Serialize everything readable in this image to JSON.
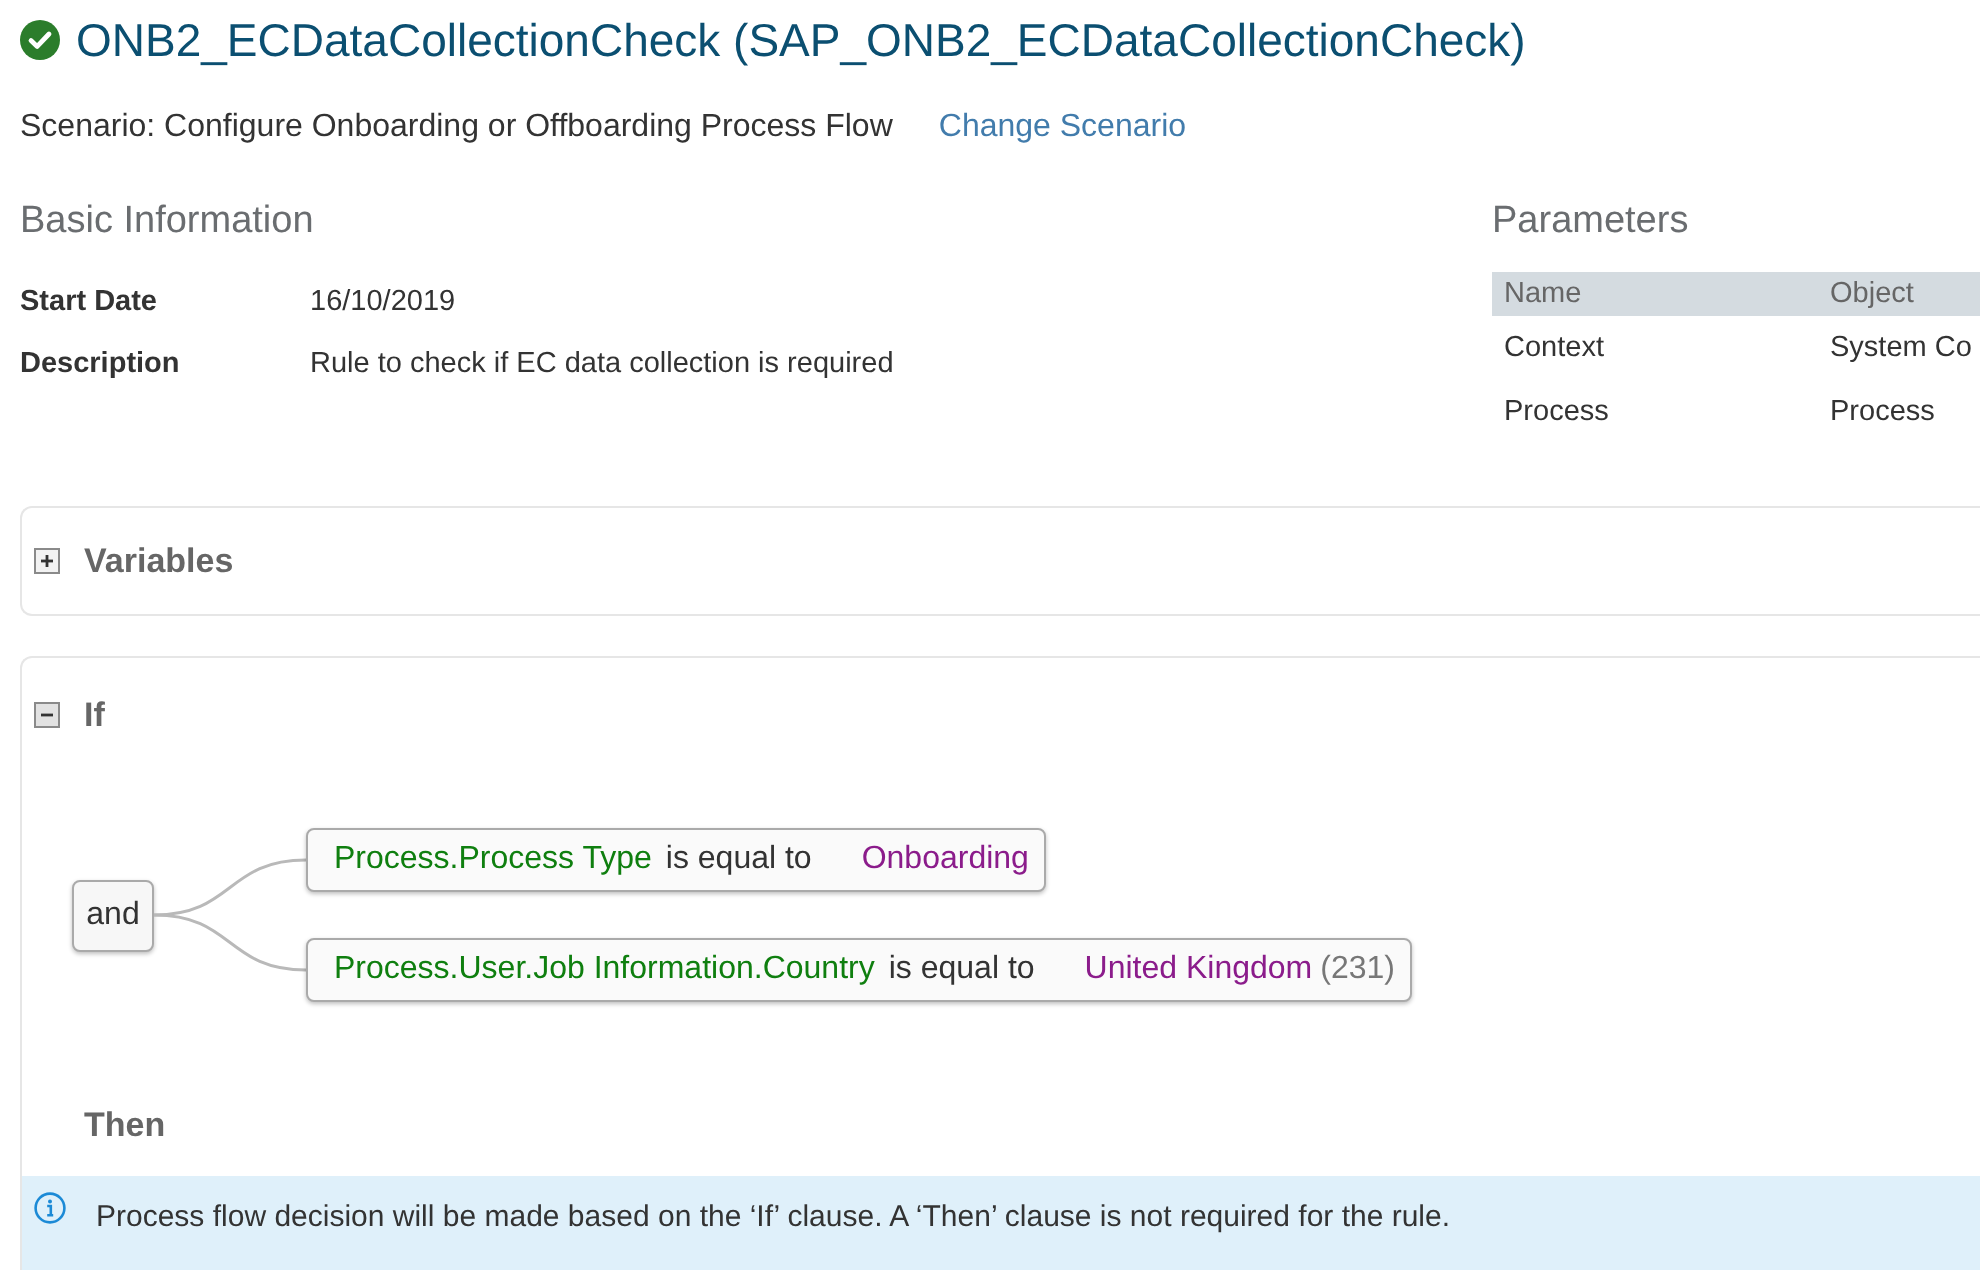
{
  "title": "ONB2_ECDataCollectionCheck (SAP_ONB2_ECDataCollectionCheck)",
  "scenario": {
    "text": "Scenario: Configure Onboarding or Offboarding Process Flow",
    "link": "Change Scenario"
  },
  "basic_information": {
    "heading": "Basic Information",
    "fields": [
      {
        "label": "Start Date",
        "value": "16/10/2019"
      },
      {
        "label": "Description",
        "value": "Rule to check if EC data collection is required"
      }
    ]
  },
  "parameters": {
    "heading": "Parameters",
    "columns": [
      "Name",
      "Object"
    ],
    "rows": [
      [
        "Context",
        "System Co"
      ],
      [
        "Process",
        "Process"
      ]
    ]
  },
  "sections": [
    {
      "title": "Variables",
      "expanded": false
    },
    {
      "title": "If",
      "expanded": true,
      "operator": "and",
      "conditions": [
        {
          "field": "Process.Process Type",
          "comparison": "is equal to",
          "value": "Onboarding"
        },
        {
          "field": "Process.User.Job Information.Country",
          "comparison": "is equal to",
          "value": "United Kingdom",
          "code": "(231)"
        }
      ],
      "then": {
        "title": "Then",
        "message": "Process flow decision will be made based on the ‘If’ clause. A ‘Then’ clause is not required for the rule."
      }
    }
  ]
}
